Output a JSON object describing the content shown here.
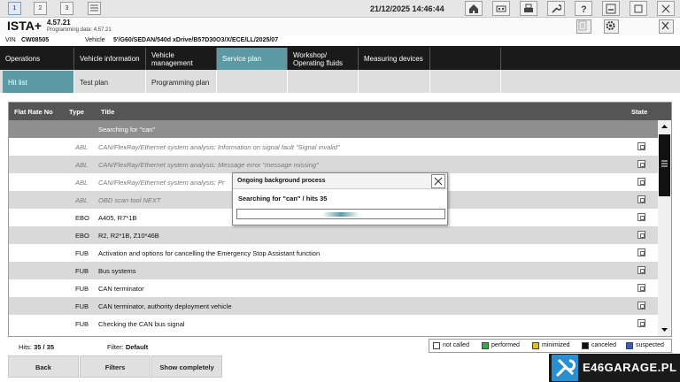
{
  "window_tabs": [
    "1",
    "2",
    "3"
  ],
  "datetime": "21/12/2025 14:46:44",
  "brand": "ISTA+",
  "version": "4.57.21",
  "programming_data_label": "Programming data:",
  "programming_data_value": "4.57.21",
  "vin_label": "VIN",
  "vin_value": "CW08505",
  "vehicle_label": "Vehicle",
  "vehicle_value": "5'/G60/SEDAN/540d xDrive/B57D30O3/X/ECE/LL/2025/07",
  "nav": [
    {
      "label": "Operations"
    },
    {
      "label": "Vehicle information"
    },
    {
      "label": "Vehicle management"
    },
    {
      "label": "Service plan"
    },
    {
      "label": "Workshop/ Operating fluids"
    },
    {
      "label": "Measuring devices"
    }
  ],
  "subnav": [
    {
      "label": "Hit list"
    },
    {
      "label": "Test plan"
    },
    {
      "label": "Programming plan"
    }
  ],
  "table": {
    "headers": {
      "flat_rate": "Flat Rate No",
      "type": "Type",
      "title": "Title",
      "state": "State"
    },
    "searching_text": "Searching for \"can\"",
    "rows": [
      {
        "type": "ABL",
        "title": "CAN/FlexRay/Ethernet system analysis: Information on signal fault \"Signal invalid\""
      },
      {
        "type": "ABL",
        "title": "CAN/FlexRay/Ethernet system analysis: Message error \"message missing\""
      },
      {
        "type": "ABL",
        "title": "CAN/FlexRay/Ethernet system analysis: Pr"
      },
      {
        "type": "ABL",
        "title": "OBD scan tool NEXT"
      },
      {
        "type": "EBO",
        "title": "A405, R7*1B"
      },
      {
        "type": "EBO",
        "title": "R2, R2*1B, Z10*46B"
      },
      {
        "type": "FUB",
        "title": "Activation and options for cancelling the Emergency Stop Assistant function"
      },
      {
        "type": "FUB",
        "title": "Bus systems"
      },
      {
        "type": "FUB",
        "title": "CAN terminator"
      },
      {
        "type": "FUB",
        "title": "CAN terminator, authority deployment vehicle"
      },
      {
        "type": "FUB",
        "title": "Checking the CAN bus signal"
      }
    ]
  },
  "dialog": {
    "title": "Ongoing background process",
    "message": "Searching for \"can\" / hits 35",
    "progress": 0.5
  },
  "footer": {
    "hits_label": "Hits:",
    "hits_value": "35 / 35",
    "filter_label": "Filter:",
    "filter_value": "Default",
    "legend": [
      {
        "label": "not called",
        "color": "#ffffff"
      },
      {
        "label": "performed",
        "color": "#3aa845"
      },
      {
        "label": "minimized",
        "color": "#e0c020"
      },
      {
        "label": "canceled",
        "color": "#111111"
      },
      {
        "label": "suspected",
        "color": "#3060c0"
      }
    ],
    "buttons": {
      "back": "Back",
      "filters": "Filters",
      "show_completely": "Show completely"
    }
  },
  "watermark": "E46GARAGE.PL",
  "accent_color": "#5b9aa5"
}
